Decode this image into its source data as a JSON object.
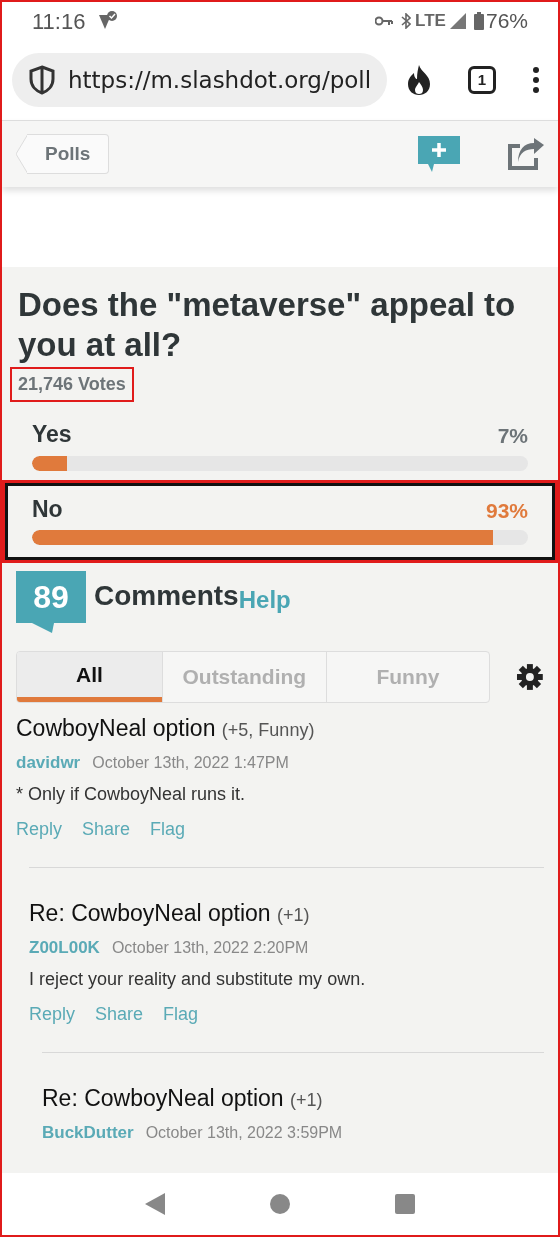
{
  "status_bar": {
    "time": "11:16",
    "network": "LTE",
    "battery": "76%"
  },
  "browser": {
    "url": "https://m.slashdot.org/poll",
    "tab_count": "1"
  },
  "nav": {
    "back_label": "Polls"
  },
  "poll": {
    "question": "Does the \"metaverse\" appeal to you at all?",
    "votes": {
      "text": "21,746 Votes",
      "highlighted": true
    },
    "options": [
      {
        "label": "Yes",
        "percent": "7%",
        "level": 0.07,
        "highlighted": false
      },
      {
        "label": "No",
        "percent": "93%",
        "level": 0.93,
        "highlighted": true
      }
    ]
  },
  "comments_header": {
    "count": "89",
    "title": "Comments",
    "help": "Help"
  },
  "tabs": [
    {
      "label": "All",
      "selected": true
    },
    {
      "label": "Outstanding",
      "selected": false
    },
    {
      "label": "Funny",
      "selected": false
    }
  ],
  "comments": [
    {
      "title": "CowboyNeal option",
      "score": "(+5, Funny)",
      "author": "davidwr",
      "date": "October 13th, 2022 1:47PM",
      "body": "* Only if CowboyNeal runs it.",
      "actions": [
        "Reply",
        "Share",
        "Flag"
      ],
      "children": [
        {
          "title": "Re: CowboyNeal option",
          "score": "(+1)",
          "author": "Z00L00K",
          "date": "October 13th, 2022 2:20PM",
          "body": "I reject your reality and substitute my own.",
          "actions": [
            "Reply",
            "Share",
            "Flag"
          ],
          "children": [
            {
              "title": "Re: CowboyNeal option",
              "score": "(+1)",
              "author": "BuckDutter",
              "date": "October 13th, 2022 3:59PM"
            }
          ]
        }
      ]
    }
  ]
}
